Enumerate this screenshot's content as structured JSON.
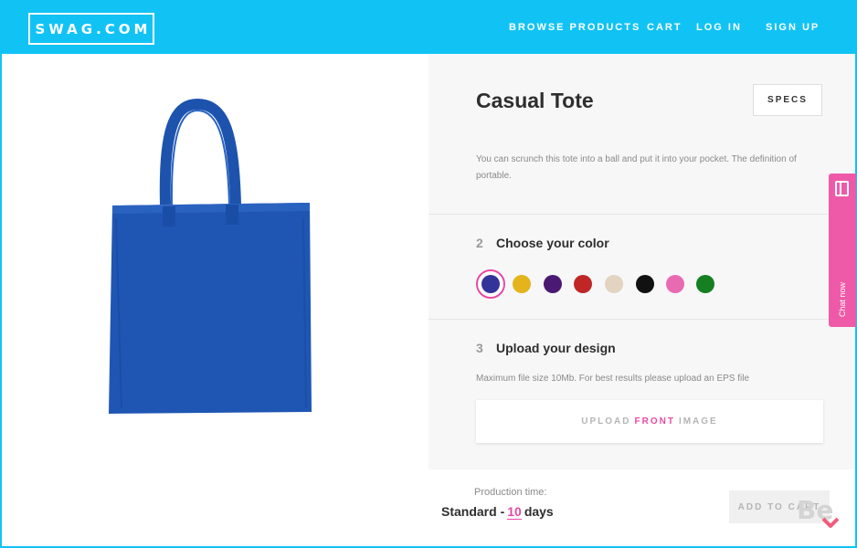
{
  "brand": {
    "logo_text": "SWAG.COM",
    "accent_color": "#11c3f5",
    "highlight_color": "#e94aa3"
  },
  "nav": {
    "browse": "BROWSE PRODUCTS",
    "cart": "CART",
    "login": "LOG IN",
    "signup": "SIGN UP"
  },
  "product": {
    "title": "Casual Tote",
    "specs_label": "SPECS",
    "description": "You can scrunch this tote into a ball and put it into your pocket. The definition of portable.",
    "image_icon": "tote-bag-image",
    "image_color": "#1f56b3"
  },
  "step_color": {
    "number": "2",
    "title": "Choose your color",
    "swatches": [
      {
        "name": "navy",
        "hex": "#33339a",
        "selected": true
      },
      {
        "name": "gold",
        "hex": "#e3b41c",
        "selected": false
      },
      {
        "name": "purple",
        "hex": "#4a1a72",
        "selected": false
      },
      {
        "name": "red",
        "hex": "#c02626",
        "selected": false
      },
      {
        "name": "natural",
        "hex": "#e3d3c1",
        "selected": false
      },
      {
        "name": "black",
        "hex": "#111111",
        "selected": false
      },
      {
        "name": "pink",
        "hex": "#e86bb2",
        "selected": false
      },
      {
        "name": "green",
        "hex": "#157f22",
        "selected": false
      }
    ]
  },
  "step_upload": {
    "number": "3",
    "title": "Upload your design",
    "note": "Maximum file size 10Mb. For best results please upload an EPS file",
    "button_pre": "UPLOAD",
    "button_accent": "FRONT",
    "button_post": "IMAGE"
  },
  "footer": {
    "production_label": "Production time:",
    "production_prefix": "Standard -",
    "production_days": "10",
    "production_unit": "days",
    "add_to_cart": "ADD TO CART"
  },
  "chat": {
    "label": "Chat now",
    "icon": "chat-panel-icon"
  },
  "watermark": {
    "text": "Be",
    "icon": "behance-logo"
  }
}
